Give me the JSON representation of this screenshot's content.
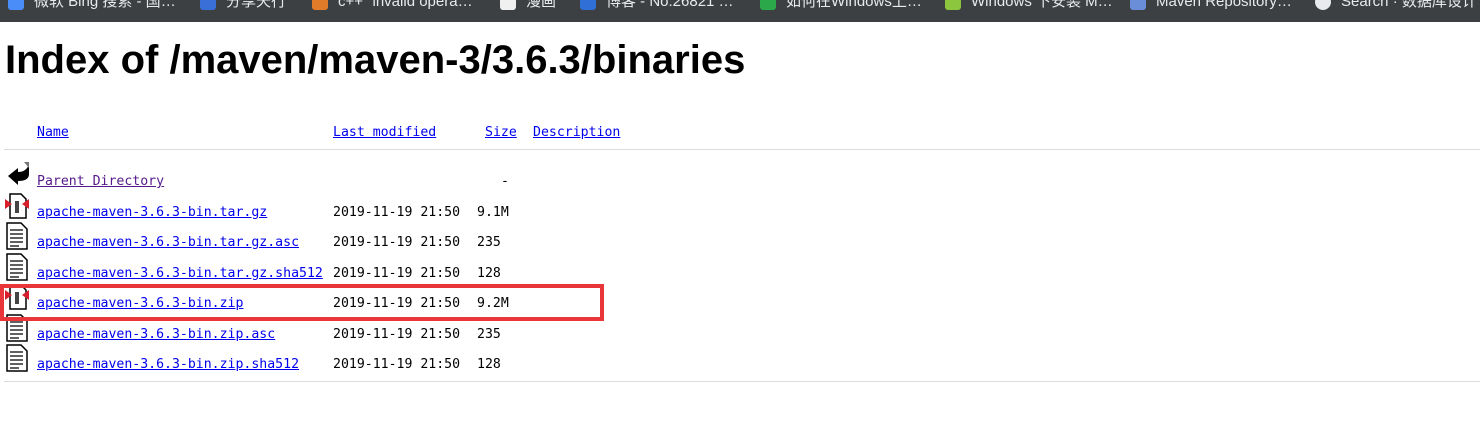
{
  "bookmarks": [
    {
      "label": "微软 Bing 搜索 - 国…",
      "icon": "bing-icon",
      "color": "#4a8df8"
    },
    {
      "label": "分享天行",
      "icon": "blue-app-icon",
      "color": "#3b6fd8"
    },
    {
      "label": "c++ \"invalid opera…",
      "icon": "orange-doc-icon",
      "color": "#e07b2a"
    },
    {
      "label": "漫画",
      "icon": "white-doc-icon",
      "color": "#f0f0f0"
    },
    {
      "label": "博客 - No.26821 …",
      "icon": "blog-icon",
      "color": "#2f6fd6"
    },
    {
      "label": "如何在Windows上…",
      "icon": "green-app-icon",
      "color": "#2aa84a"
    },
    {
      "label": "Windows 下安装 M…",
      "icon": "green-app-icon",
      "color": "#8cc63f"
    },
    {
      "label": "Maven Repository…",
      "icon": "maven-icon",
      "color": "#6a8fd8"
    },
    {
      "label": "Search · 数据库设计",
      "icon": "github-icon",
      "color": "#e8eaed"
    }
  ],
  "page": {
    "title": "Index of /maven/maven-3/3.6.3/binaries"
  },
  "table": {
    "headers": {
      "name": "Name",
      "last_modified": "Last modified",
      "size": "Size",
      "description": "Description"
    },
    "parent": {
      "name": "Parent Directory",
      "size": "-",
      "icon": "back-arrow-icon"
    },
    "rows": [
      {
        "name": "apache-maven-3.6.3-bin.tar.gz",
        "modified": "2019-11-19 21:50",
        "size": "9.1M",
        "icon": "compressed-file-icon"
      },
      {
        "name": "apache-maven-3.6.3-bin.tar.gz.asc",
        "modified": "2019-11-19 21:50",
        "size": "235",
        "icon": "text-file-icon"
      },
      {
        "name": "apache-maven-3.6.3-bin.tar.gz.sha512",
        "modified": "2019-11-19 21:50",
        "size": "128",
        "icon": "text-file-icon"
      },
      {
        "name": "apache-maven-3.6.3-bin.zip",
        "modified": "2019-11-19 21:50",
        "size": "9.2M",
        "icon": "compressed-file-icon"
      },
      {
        "name": "apache-maven-3.6.3-bin.zip.asc",
        "modified": "2019-11-19 21:50",
        "size": "235",
        "icon": "text-file-icon"
      },
      {
        "name": "apache-maven-3.6.3-bin.zip.sha512",
        "modified": "2019-11-19 21:50",
        "size": "128",
        "icon": "text-file-icon"
      }
    ]
  },
  "annotation": {
    "highlight_color": "#e8363b",
    "highlighted_row": "apache-maven-3.6.3-bin.zip"
  }
}
